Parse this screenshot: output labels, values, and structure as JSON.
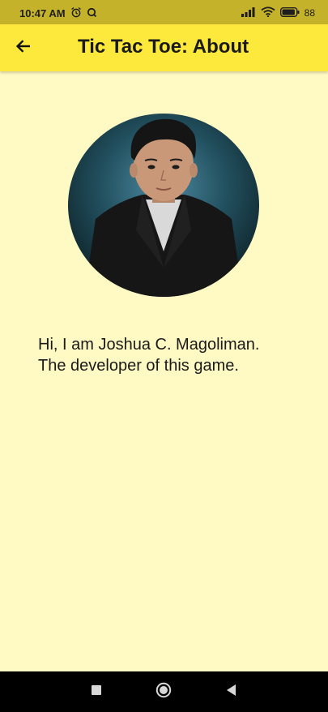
{
  "status_bar": {
    "time": "10:47 AM",
    "battery": "88"
  },
  "app_bar": {
    "title": "Tic Tac Toe: About"
  },
  "about": {
    "line1": "Hi, I am Joshua C. Magoliman.",
    "line2": "The developer of this game."
  },
  "icons": {
    "status": [
      "alarm-icon",
      "q-icon",
      "signal-icon",
      "wifi-icon",
      "battery-icon"
    ],
    "app_bar": [
      "back-arrow-icon"
    ],
    "nav_bar": [
      "recents-icon",
      "home-icon",
      "back-icon"
    ]
  },
  "colors": {
    "status_bar": "#C5B22B",
    "app_bar": "#FDE93B",
    "background": "#FFF9C3",
    "nav_bar": "#000000"
  }
}
